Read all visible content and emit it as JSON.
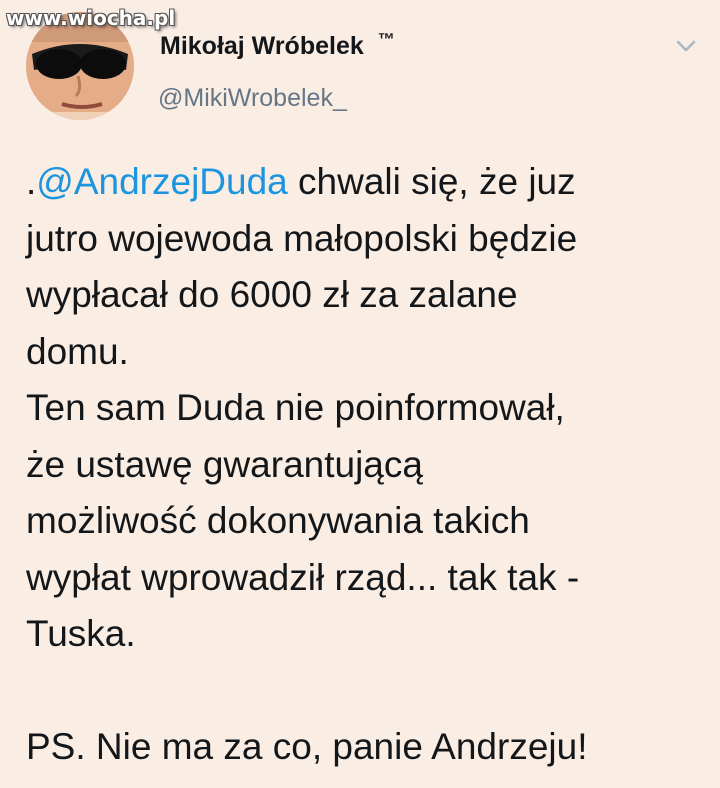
{
  "watermark": "www.wiocha.pl",
  "author": {
    "display_name": "Mikołaj Wróbelek",
    "badge": "™",
    "handle": "@MikiWrobelek_"
  },
  "icons": {
    "menu": "chevron-down-icon",
    "avatar": "profile-photo"
  },
  "colors": {
    "background": "#faede4",
    "mention": "#1b95e0",
    "handle": "#657786",
    "text": "#14171a"
  },
  "tweet": {
    "line1_prefix": ".",
    "line1_mention": "@AndrzejDuda",
    "line1_rest": " chwali się, że juz",
    "line2": "jutro wojewoda małopolski będzie",
    "line3": "wypłacał do 6000 zł za zalane",
    "line4": "domu.",
    "line5": "Ten sam Duda nie poinformował,",
    "line6": "że ustawę gwarantującą",
    "line7": "możliwość dokonywania takich",
    "line8": "wypłat wprowadził rząd... tak tak -",
    "line9": "Tuska.",
    "line10": "PS. Nie ma za co, panie Andrzeju!"
  }
}
